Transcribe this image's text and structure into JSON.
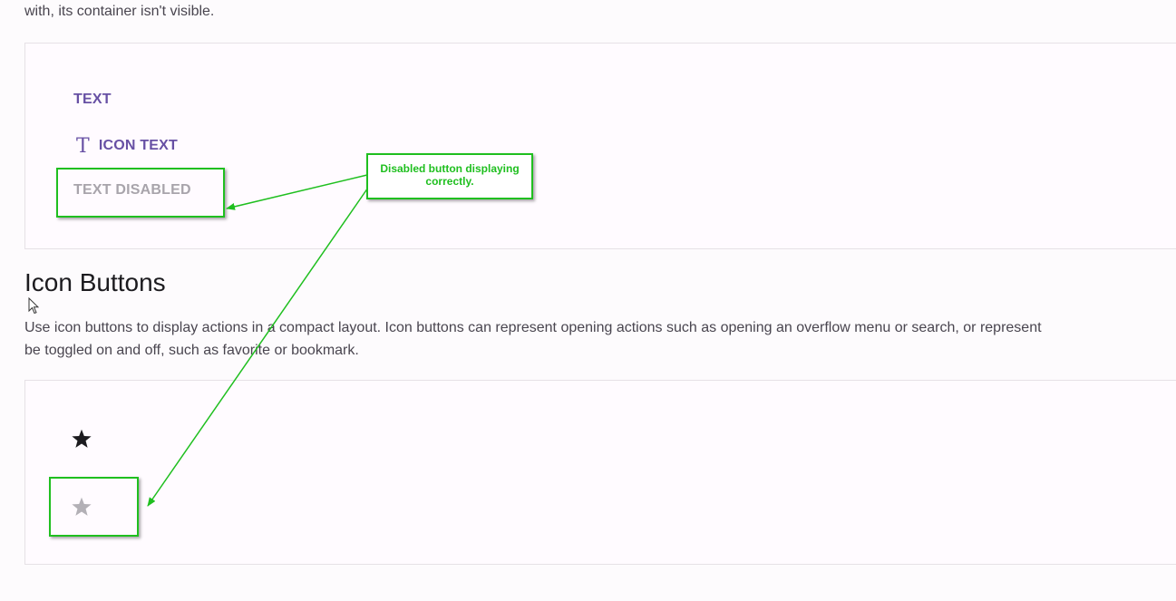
{
  "intro": {
    "text": "with, its container isn't visible."
  },
  "text_buttons": {
    "text_label": "TEXT",
    "icon_text_label": "ICON TEXT",
    "icon_text_glyph": "T",
    "disabled_label": "TEXT DISABLED"
  },
  "icon_buttons_section": {
    "heading": "Icon Buttons",
    "description_line1": "Use icon buttons to display actions in a compact layout. Icon buttons can represent opening actions such as opening an overflow menu or search, or represent",
    "description_line2": "be toggled on and off, such as favorite or bookmark."
  },
  "icon_buttons": {
    "enabled_icon": "star-icon",
    "disabled_icon": "star-icon"
  },
  "annotation": {
    "callout_text": "Disabled button displaying correctly."
  },
  "colors": {
    "primary": "#6750a4",
    "disabled": "#a8a4ab",
    "annotation": "#1fbf1f",
    "star_enabled": "#1c1b1f",
    "star_disabled": "#b3b0b6"
  }
}
